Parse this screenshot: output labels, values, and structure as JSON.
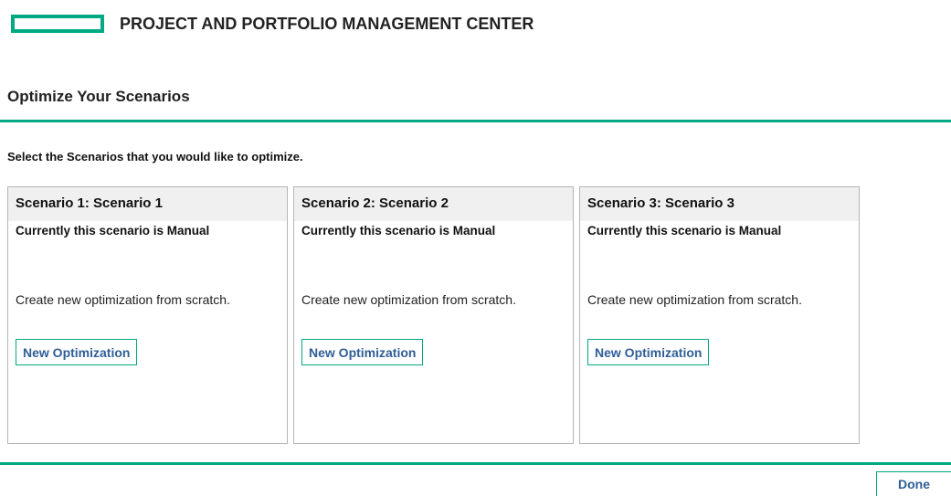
{
  "header": {
    "app_title": "PROJECT AND PORTFOLIO MANAGEMENT CENTER",
    "logo_color": "#01a982"
  },
  "page": {
    "title": "Optimize Your Scenarios",
    "instructions": "Select the Scenarios that you would like to optimize."
  },
  "scenarios": [
    {
      "title": "Scenario 1: Scenario 1",
      "status": "Currently this scenario is Manual",
      "description": "Create new optimization from scratch.",
      "button_label": "New Optimization"
    },
    {
      "title": "Scenario 2: Scenario 2",
      "status": "Currently this scenario is Manual",
      "description": "Create new optimization from scratch.",
      "button_label": "New Optimization"
    },
    {
      "title": "Scenario 3: Scenario 3",
      "status": "Currently this scenario is Manual",
      "description": "Create new optimization from scratch.",
      "button_label": "New Optimization"
    }
  ],
  "footer": {
    "done_label": "Done"
  },
  "colors": {
    "accent": "#01a982",
    "link_text": "#2f5e96",
    "card_header_bg": "#f0f0f0"
  }
}
